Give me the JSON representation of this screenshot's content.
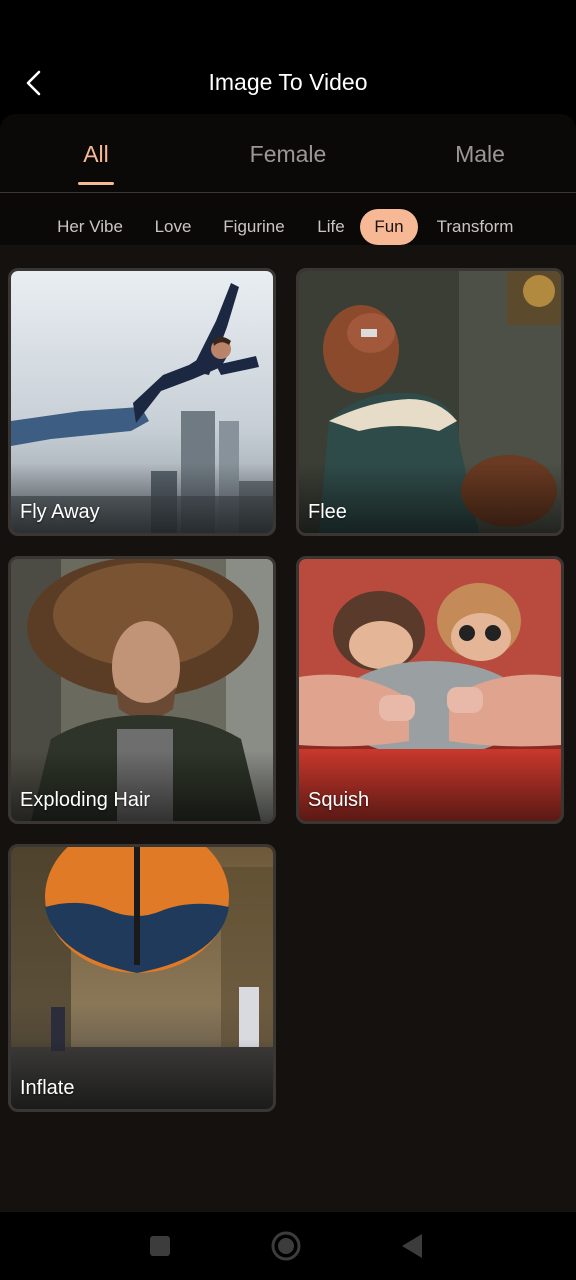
{
  "header": {
    "title": "Image To Video",
    "back_icon": "chevron-left-icon"
  },
  "tabs": [
    {
      "label": "All",
      "active": true
    },
    {
      "label": "Female",
      "active": false
    },
    {
      "label": "Male",
      "active": false
    }
  ],
  "categories": [
    {
      "label": "Her Vibe",
      "active": false
    },
    {
      "label": "Love",
      "active": false
    },
    {
      "label": "Figurine",
      "active": false
    },
    {
      "label": "Life",
      "active": false
    },
    {
      "label": "Fun",
      "active": true
    },
    {
      "label": "Transform",
      "active": false
    }
  ],
  "cards": [
    {
      "label": "Fly Away"
    },
    {
      "label": "Flee"
    },
    {
      "label": "Exploding Hair"
    },
    {
      "label": "Squish"
    },
    {
      "label": "Inflate"
    }
  ],
  "navbar": {
    "recents_icon": "square-icon",
    "home_icon": "circle-home-icon",
    "back_icon": "triangle-back-icon"
  },
  "colors": {
    "accent": "#f6b895",
    "background": "#15110f",
    "tab_inactive": "#9c9795"
  }
}
